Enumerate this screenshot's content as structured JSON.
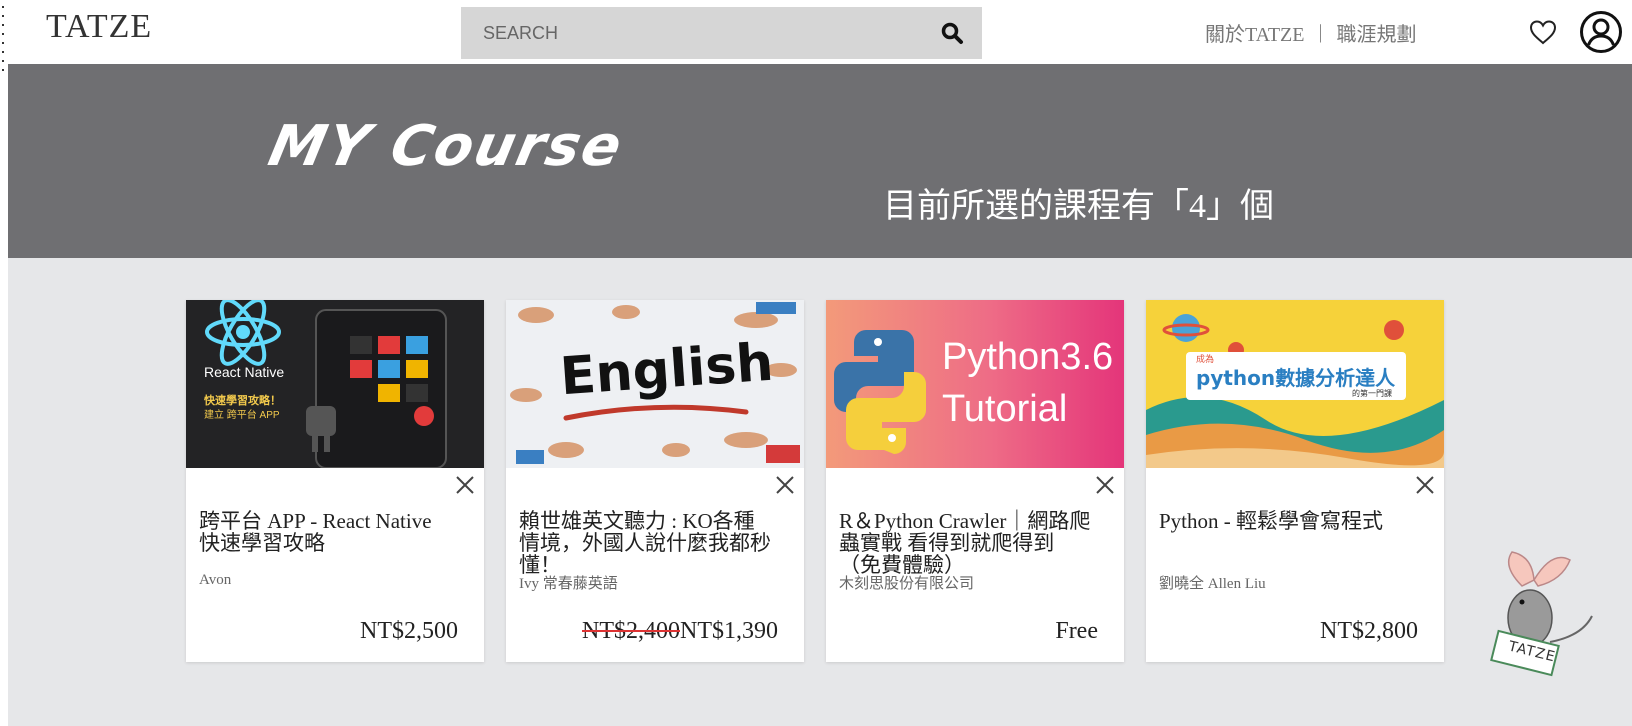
{
  "header": {
    "logo": "TATZE",
    "search_placeholder": "SEARCH",
    "nav": [
      "關於TATZE",
      "|",
      "職涯規劃"
    ]
  },
  "banner": {
    "title": "MY Course",
    "subtitle": "目前所選的課程有「4」個"
  },
  "courses": [
    {
      "thumb_label_1": "React Native",
      "thumb_label_2": "快速學習攻略！",
      "thumb_label_3": "建立 跨平台 APP",
      "title": "跨平台 APP - React Native 快速學習攻略",
      "author": "Avon",
      "price": "NT$2,500"
    },
    {
      "thumb_label": "English",
      "title": "賴世雄英文聽力 : KO各種情境，外國人說什麼我都秒懂！",
      "author": "Ivy 常春藤英語",
      "old_price": "NT$2,400",
      "price": "NT$1,390"
    },
    {
      "thumb_line_1": "Python3.6",
      "thumb_line_2": "Tutorial",
      "title": "R＆Python Crawler｜網路爬蟲實戰 看得到就爬得到（免費體驗）",
      "author": "木刻思股份有限公司",
      "price": "Free"
    },
    {
      "thumb_small": "成為",
      "thumb_main": "python數據分析達人",
      "thumb_tag": "的第一門課",
      "title": "Python - 輕鬆學會寫程式",
      "author": "劉曉全 Allen Liu",
      "price": "NT$2,800"
    }
  ],
  "mascot_label": "TATZE",
  "colors": {
    "banner": "#6f6f72",
    "content_bg": "#e6e7e9",
    "search_bg": "#d6d6d6",
    "react_blue": "#61dafb",
    "python_gradient_start": "#f08d7a",
    "python_gradient_end": "#e8327a"
  },
  "icons": [
    "search-icon",
    "heart-icon",
    "user-icon",
    "close-icon"
  ]
}
